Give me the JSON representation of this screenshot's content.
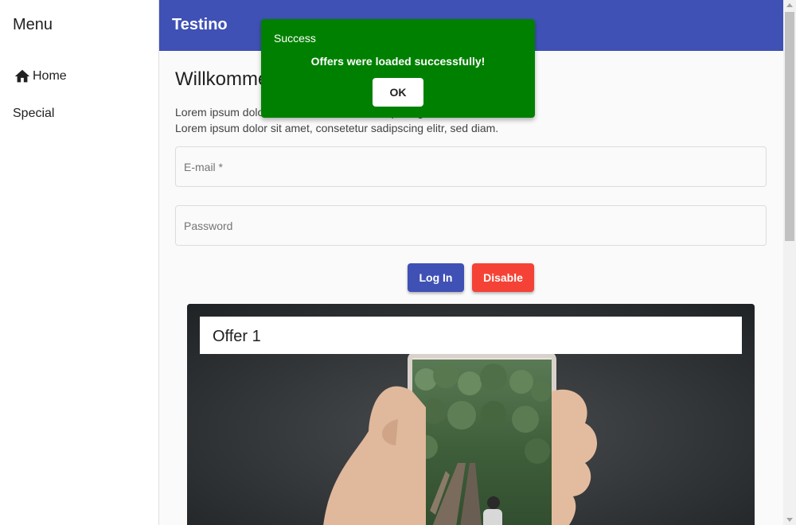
{
  "sidebar": {
    "title": "Menu",
    "items": [
      {
        "label": "Home",
        "icon": "home-icon"
      },
      {
        "label": "Special"
      }
    ]
  },
  "header": {
    "title": "Testino"
  },
  "main": {
    "welcome": "Willkommen",
    "lorem_line1": "Lorem ipsum dolor sit amet, consetetur sadipscing elitr, sed diam.",
    "lorem_line2": "Lorem ipsum dolor sit amet, consetetur sadipscing elitr, sed diam.",
    "email": {
      "placeholder": "E-mail *",
      "value": ""
    },
    "password": {
      "placeholder": "Password",
      "value": ""
    },
    "login_label": "Log In",
    "disable_label": "Disable"
  },
  "offer": {
    "title": "Offer 1"
  },
  "toast": {
    "title": "Success",
    "message": "Offers were loaded successfully!",
    "ok_label": "OK"
  },
  "colors": {
    "primary": "#3f51b5",
    "danger": "#f44336",
    "success": "#008000"
  }
}
